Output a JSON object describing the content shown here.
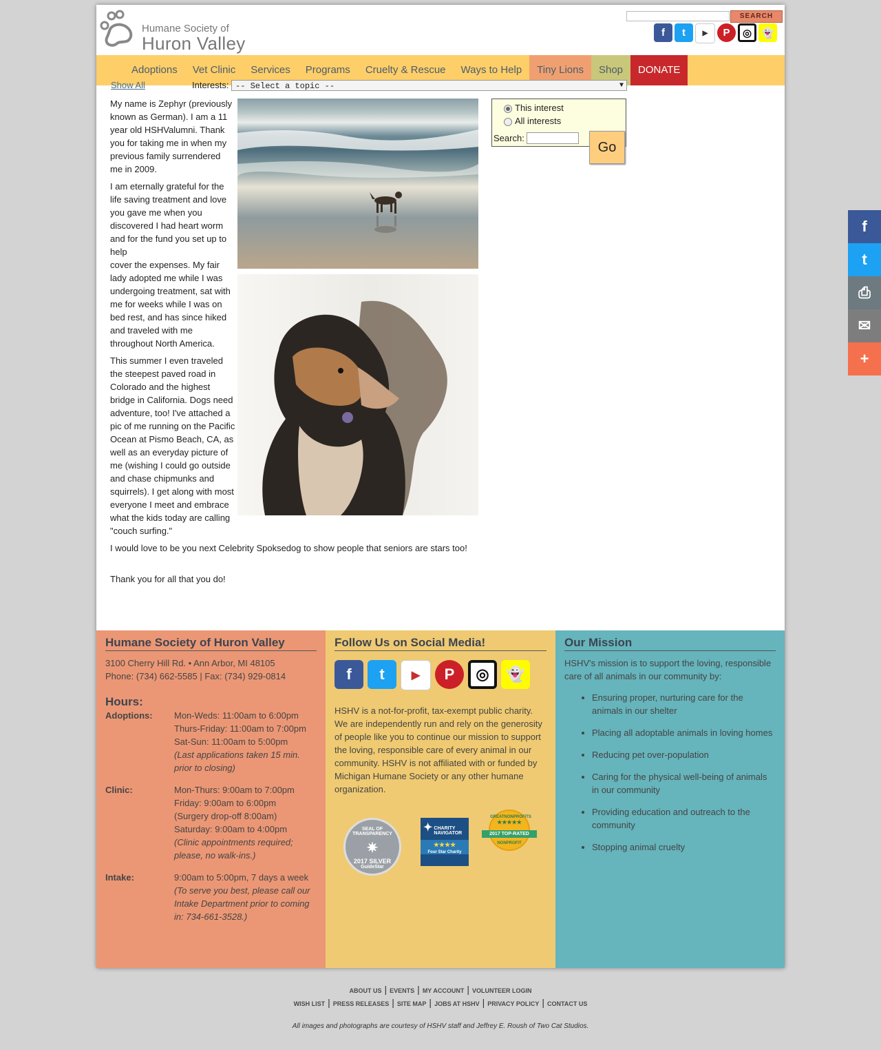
{
  "header": {
    "logo_line1": "Humane Society of",
    "logo_line2": "Huron Valley",
    "search_button": "SEARCH"
  },
  "nav": {
    "items": [
      "Adoptions",
      "Vet Clinic",
      "Services",
      "Programs",
      "Cruelty & Rescue",
      "Ways to Help",
      "Tiny Lions",
      "Shop",
      "DONATE"
    ]
  },
  "filter": {
    "show_all": "Show All",
    "interests_label": "Interests:",
    "interests_value": "-- Select a topic --"
  },
  "searchbox": {
    "option_this": "This interest",
    "option_all": "All interests",
    "search_label": "Search:",
    "go": "Go"
  },
  "story": {
    "p1": "My name is Zephyr (previously known as German). I am a 11 year old HSHValumni. Thank you for taking me in when my previous family surrendered me in 2009.",
    "p2": "I am eternally grateful for the life saving treatment and love you gave me when you discovered I had heart worm and for the fund you set up to help",
    "p2b": "cover the expenses. My fair lady adopted me while I was undergoing treatment, sat with me for weeks while I was on bed rest, and has since hiked and traveled with me throughout North America.",
    "p3": "This summer I even traveled the steepest paved road in Colorado and the highest bridge in California. Dogs need adventure, too! I've attached a pic of me running on the Pacific Ocean at Pismo Beach, CA, as well as an everyday picture of me (wishing I could go outside and chase chipmunks and squirrels). I get along with most everyone I meet and embrace what the kids today are calling \"couch surfing.\"",
    "p4": "I would love to be you next Celebrity Spoksedog to show people that seniors are stars too!",
    "p5": "Thank you for all that you do!"
  },
  "footer": {
    "col1": {
      "title": "Humane Society of Huron Valley",
      "address": "3100 Cherry Hill Rd. • Ann Arbor, MI 48105",
      "phone": "Phone: (734) 662-5585 | Fax: (734) 929-0814",
      "hours_title": "Hours:",
      "adoptions_label": "Adoptions:",
      "adoptions_1": "Mon-Weds: 11:00am to 6:00pm",
      "adoptions_2": "Thurs-Friday: 11:00am to 7:00pm",
      "adoptions_3": "Sat-Sun: 11:00am to 5:00pm",
      "adoptions_note": "(Last applications taken 15 min. prior to closing)",
      "clinic_label": "Clinic:",
      "clinic_1": "Mon-Thurs: 9:00am to 7:00pm",
      "clinic_2": "Friday: 9:00am to 6:00pm",
      "clinic_3": "(Surgery drop-off 8:00am)",
      "clinic_4": "Saturday: 9:00am to 4:00pm",
      "clinic_note": "(Clinic appointments required; please, no walk-ins.)",
      "intake_label": "Intake:",
      "intake_1": "9:00am to 5:00pm, 7 days a week",
      "intake_note": "(To serve you best, please call our Intake Department prior to coming in: 734-661-3528.)"
    },
    "col2": {
      "title": "Follow Us on Social Media!",
      "body": "HSHV is a not-for-profit, tax-exempt public charity. We are independently run and rely on the generosity of people like you to continue our mission to support the loving, responsible care of every animal in our community. HSHV is not affiliated with or funded by Michigan Humane Society or any other humane organization.",
      "badge1_a": "SEAL OF TRANSPARENCY",
      "badge1_b": "2017 SILVER",
      "badge1_c": "GuideStar",
      "badge2_a": "CHARITY",
      "badge2_b": "NAVIGATOR",
      "badge2_c": "Four Star Charity",
      "badge3_a": "GREATNONPROFITS",
      "badge3_b": "2017 TOP-RATED",
      "badge3_c": "NONPROFIT"
    },
    "col3": {
      "title": "Our Mission",
      "intro": "HSHV's mission is to support the loving, responsible care of all animals in our community by:",
      "items": [
        "Ensuring proper, nurturing care for the animals in our shelter",
        "Placing all adoptable animals in loving homes",
        "Reducing pet over-population",
        "Caring for the physical well-being of animals in our community",
        "Providing education and outreach to the community",
        "Stopping animal cruelty"
      ]
    }
  },
  "bottom_links": {
    "row1": [
      "ABOUT US",
      "EVENTS",
      "MY ACCOUNT",
      "VOLUNTEER LOGIN"
    ],
    "row2": [
      "WISH LIST",
      "PRESS RELEASES",
      "SITE MAP",
      "JOBS AT HSHV",
      "PRIVACY POLICY",
      "CONTACT US"
    ]
  },
  "credit": "All images and photographs are courtesy of HSHV staff and Jeffrey E. Roush of Two Cat Studios.",
  "colors": {
    "nav_bg": "#fece68",
    "donate": "#c8282b",
    "col1": "#eb9775",
    "col2": "#efca72",
    "col3": "#66b4bc",
    "facebook": "#3b5998",
    "twitter": "#1da1f2"
  },
  "icons": [
    "facebook-icon",
    "twitter-icon",
    "youtube-icon",
    "pinterest-icon",
    "instagram-icon",
    "snapchat-icon",
    "print-icon",
    "email-icon",
    "plus-icon"
  ]
}
